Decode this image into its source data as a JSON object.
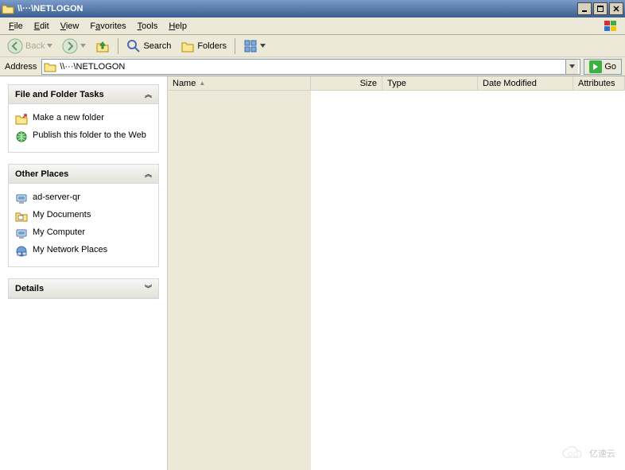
{
  "window": {
    "title": "\\\\···\\NETLOGON"
  },
  "menu": {
    "file": "File",
    "edit": "Edit",
    "view": "View",
    "favorites": "Favorites",
    "tools": "Tools",
    "help": "Help"
  },
  "toolbar": {
    "back": "Back",
    "search": "Search",
    "folders": "Folders"
  },
  "address": {
    "label": "Address",
    "value": "\\\\···\\NETLOGON",
    "go": "Go"
  },
  "sidepane": {
    "tasks": {
      "title": "File and Folder Tasks",
      "items": [
        {
          "label": "Make a new folder"
        },
        {
          "label": "Publish this folder to the Web"
        }
      ]
    },
    "other": {
      "title": "Other Places",
      "items": [
        {
          "label": "ad-server-qr"
        },
        {
          "label": "My Documents"
        },
        {
          "label": "My Computer"
        },
        {
          "label": "My Network Places"
        }
      ]
    },
    "details": {
      "title": "Details"
    }
  },
  "columns": {
    "name": "Name",
    "size": "Size",
    "type": "Type",
    "date": "Date Modified",
    "attr": "Attributes"
  },
  "watermark": "亿速云"
}
